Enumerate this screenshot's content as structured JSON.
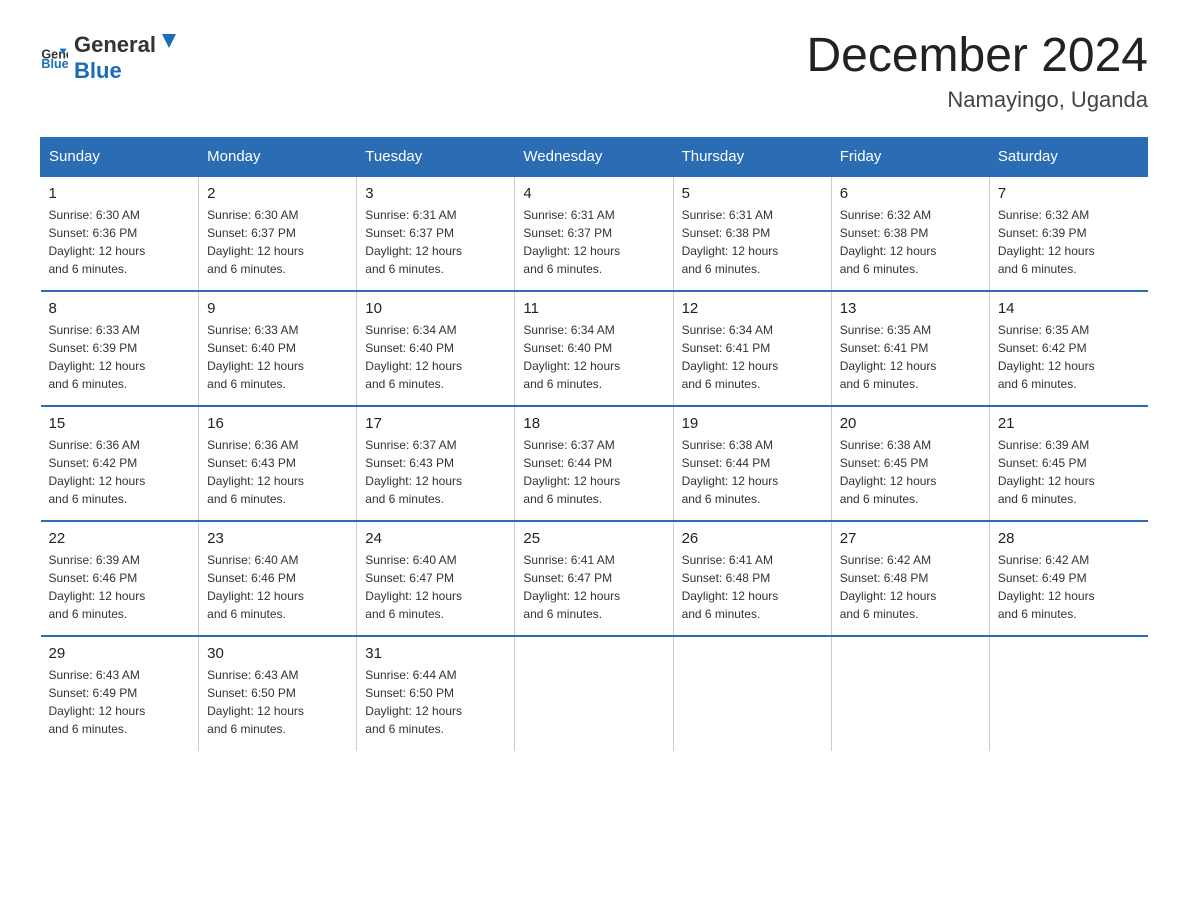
{
  "logo": {
    "general": "General",
    "blue": "Blue"
  },
  "title": "December 2024",
  "location": "Namayingo, Uganda",
  "days_of_week": [
    "Sunday",
    "Monday",
    "Tuesday",
    "Wednesday",
    "Thursday",
    "Friday",
    "Saturday"
  ],
  "weeks": [
    [
      {
        "day": "1",
        "sunrise": "6:30 AM",
        "sunset": "6:36 PM",
        "daylight": "12 hours and 6 minutes."
      },
      {
        "day": "2",
        "sunrise": "6:30 AM",
        "sunset": "6:37 PM",
        "daylight": "12 hours and 6 minutes."
      },
      {
        "day": "3",
        "sunrise": "6:31 AM",
        "sunset": "6:37 PM",
        "daylight": "12 hours and 6 minutes."
      },
      {
        "day": "4",
        "sunrise": "6:31 AM",
        "sunset": "6:37 PM",
        "daylight": "12 hours and 6 minutes."
      },
      {
        "day": "5",
        "sunrise": "6:31 AM",
        "sunset": "6:38 PM",
        "daylight": "12 hours and 6 minutes."
      },
      {
        "day": "6",
        "sunrise": "6:32 AM",
        "sunset": "6:38 PM",
        "daylight": "12 hours and 6 minutes."
      },
      {
        "day": "7",
        "sunrise": "6:32 AM",
        "sunset": "6:39 PM",
        "daylight": "12 hours and 6 minutes."
      }
    ],
    [
      {
        "day": "8",
        "sunrise": "6:33 AM",
        "sunset": "6:39 PM",
        "daylight": "12 hours and 6 minutes."
      },
      {
        "day": "9",
        "sunrise": "6:33 AM",
        "sunset": "6:40 PM",
        "daylight": "12 hours and 6 minutes."
      },
      {
        "day": "10",
        "sunrise": "6:34 AM",
        "sunset": "6:40 PM",
        "daylight": "12 hours and 6 minutes."
      },
      {
        "day": "11",
        "sunrise": "6:34 AM",
        "sunset": "6:40 PM",
        "daylight": "12 hours and 6 minutes."
      },
      {
        "day": "12",
        "sunrise": "6:34 AM",
        "sunset": "6:41 PM",
        "daylight": "12 hours and 6 minutes."
      },
      {
        "day": "13",
        "sunrise": "6:35 AM",
        "sunset": "6:41 PM",
        "daylight": "12 hours and 6 minutes."
      },
      {
        "day": "14",
        "sunrise": "6:35 AM",
        "sunset": "6:42 PM",
        "daylight": "12 hours and 6 minutes."
      }
    ],
    [
      {
        "day": "15",
        "sunrise": "6:36 AM",
        "sunset": "6:42 PM",
        "daylight": "12 hours and 6 minutes."
      },
      {
        "day": "16",
        "sunrise": "6:36 AM",
        "sunset": "6:43 PM",
        "daylight": "12 hours and 6 minutes."
      },
      {
        "day": "17",
        "sunrise": "6:37 AM",
        "sunset": "6:43 PM",
        "daylight": "12 hours and 6 minutes."
      },
      {
        "day": "18",
        "sunrise": "6:37 AM",
        "sunset": "6:44 PM",
        "daylight": "12 hours and 6 minutes."
      },
      {
        "day": "19",
        "sunrise": "6:38 AM",
        "sunset": "6:44 PM",
        "daylight": "12 hours and 6 minutes."
      },
      {
        "day": "20",
        "sunrise": "6:38 AM",
        "sunset": "6:45 PM",
        "daylight": "12 hours and 6 minutes."
      },
      {
        "day": "21",
        "sunrise": "6:39 AM",
        "sunset": "6:45 PM",
        "daylight": "12 hours and 6 minutes."
      }
    ],
    [
      {
        "day": "22",
        "sunrise": "6:39 AM",
        "sunset": "6:46 PM",
        "daylight": "12 hours and 6 minutes."
      },
      {
        "day": "23",
        "sunrise": "6:40 AM",
        "sunset": "6:46 PM",
        "daylight": "12 hours and 6 minutes."
      },
      {
        "day": "24",
        "sunrise": "6:40 AM",
        "sunset": "6:47 PM",
        "daylight": "12 hours and 6 minutes."
      },
      {
        "day": "25",
        "sunrise": "6:41 AM",
        "sunset": "6:47 PM",
        "daylight": "12 hours and 6 minutes."
      },
      {
        "day": "26",
        "sunrise": "6:41 AM",
        "sunset": "6:48 PM",
        "daylight": "12 hours and 6 minutes."
      },
      {
        "day": "27",
        "sunrise": "6:42 AM",
        "sunset": "6:48 PM",
        "daylight": "12 hours and 6 minutes."
      },
      {
        "day": "28",
        "sunrise": "6:42 AM",
        "sunset": "6:49 PM",
        "daylight": "12 hours and 6 minutes."
      }
    ],
    [
      {
        "day": "29",
        "sunrise": "6:43 AM",
        "sunset": "6:49 PM",
        "daylight": "12 hours and 6 minutes."
      },
      {
        "day": "30",
        "sunrise": "6:43 AM",
        "sunset": "6:50 PM",
        "daylight": "12 hours and 6 minutes."
      },
      {
        "day": "31",
        "sunrise": "6:44 AM",
        "sunset": "6:50 PM",
        "daylight": "12 hours and 6 minutes."
      },
      null,
      null,
      null,
      null
    ]
  ],
  "labels": {
    "sunrise": "Sunrise:",
    "sunset": "Sunset:",
    "daylight": "Daylight: 12 hours"
  }
}
